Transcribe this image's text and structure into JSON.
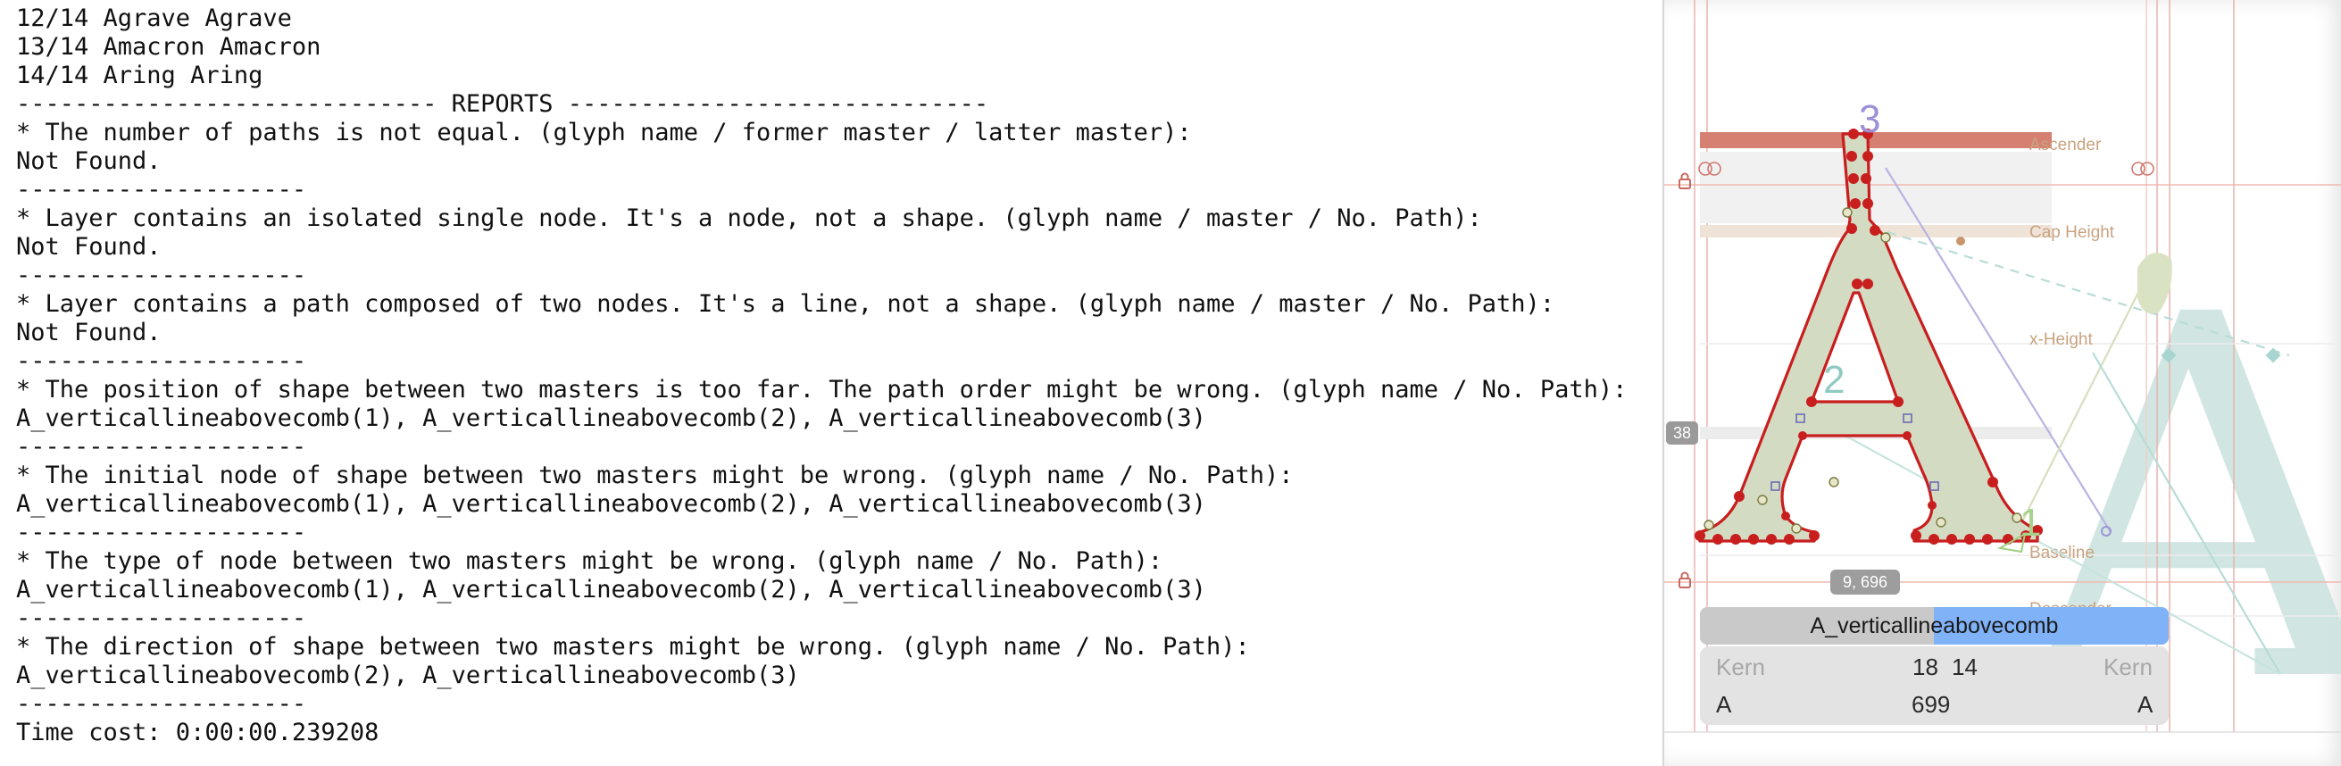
{
  "report": {
    "lines": [
      "12/14 Agrave Agrave",
      "13/14 Amacron Amacron",
      "14/14 Aring Aring",
      "----------------------------- REPORTS -----------------------------",
      "* The number of paths is not equal. (glyph name / former master / latter master):",
      "Not Found.",
      "--------------------",
      "* Layer contains an isolated single node. It's a node, not a shape. (glyph name / master / No. Path):",
      "Not Found.",
      "--------------------",
      "* Layer contains a path composed of two nodes. It's a line, not a shape. (glyph name / master / No. Path):",
      "Not Found.",
      "--------------------",
      "* The position of shape between two masters is too far. The path order might be wrong. (glyph name / No. Path):",
      "A_verticallineabovecomb(1), A_verticallineabovecomb(2), A_verticallineabovecomb(3)",
      "--------------------",
      "* The initial node of shape between two masters might be wrong. (glyph name / No. Path):",
      "A_verticallineabovecomb(1), A_verticallineabovecomb(2), A_verticallineabovecomb(3)",
      "--------------------",
      "* The type of node between two masters might be wrong. (glyph name / No. Path):",
      "A_verticallineabovecomb(1), A_verticallineabovecomb(2), A_verticallineabovecomb(3)",
      "--------------------",
      "* The direction of shape between two masters might be wrong. (glyph name / No. Path):",
      "A_verticallineabovecomb(2), A_verticallineabovecomb(3)",
      "--------------------",
      "Time cost: 0:00:00.239208"
    ]
  },
  "editor": {
    "metrics": {
      "ascender": "Ascender",
      "cap_height": "Cap Height",
      "x_height": "x-Height",
      "baseline": "Baseline",
      "descender": "Descender"
    },
    "path_numbers": {
      "p1": "1",
      "p2": "2",
      "p3": "3"
    },
    "sidebearing_badge": "38",
    "coordinate_badge": "9, 696",
    "glyph_name": "A_verticallineabovecomb",
    "kern": {
      "left_label": "Kern",
      "right_label": "Kern",
      "left_value": "18",
      "right_value": "14",
      "left_glyph": "A",
      "right_glyph": "A",
      "width": "699"
    },
    "preview_glyph": "A",
    "colors": {
      "outline": "#c81e1e",
      "fill": "#d3dcc3",
      "background_glyph": "#cfe5e1",
      "ascender_zone": "#d58070",
      "metric_label": "#c9a380"
    },
    "icons": {
      "lock_top": "lock-icon",
      "lock_bottom": "lock-icon",
      "kern_handle": "kern-handle-icon"
    }
  }
}
